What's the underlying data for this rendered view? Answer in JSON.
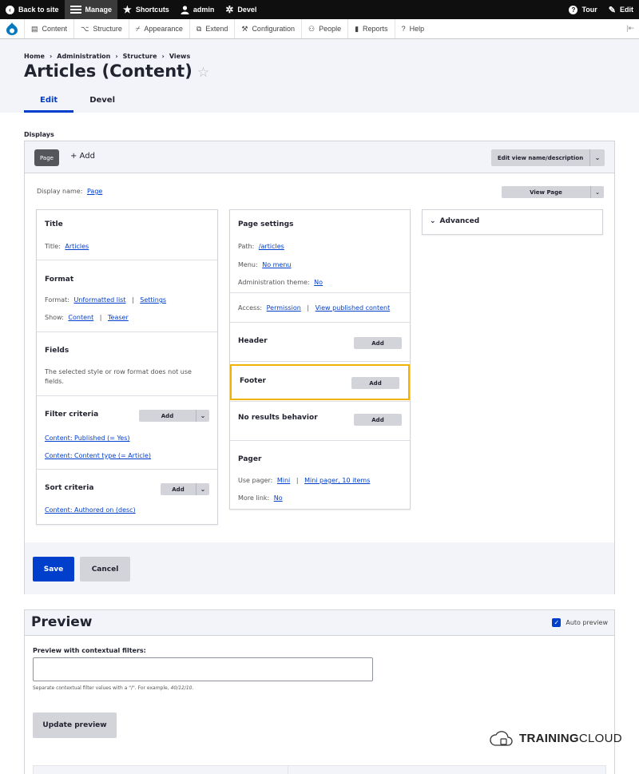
{
  "toolbar": {
    "back_to_site": "Back to site",
    "manage": "Manage",
    "shortcuts": "Shortcuts",
    "user": "admin",
    "devel": "Devel",
    "tour": "Tour",
    "edit": "Edit"
  },
  "tray": {
    "items": [
      {
        "label": "Content",
        "icon": "document-icon"
      },
      {
        "label": "Structure",
        "icon": "structure-icon"
      },
      {
        "label": "Appearance",
        "icon": "brush-icon"
      },
      {
        "label": "Extend",
        "icon": "puzzle-icon"
      },
      {
        "label": "Configuration",
        "icon": "wrench-icon"
      },
      {
        "label": "People",
        "icon": "people-icon"
      },
      {
        "label": "Reports",
        "icon": "bar-chart-icon"
      },
      {
        "label": "Help",
        "icon": "help-icon"
      }
    ]
  },
  "breadcrumb": [
    "Home",
    "Administration",
    "Structure",
    "Views"
  ],
  "page": {
    "title": "Articles (Content)",
    "star": "☆",
    "tabs": [
      "Edit",
      "Devel"
    ]
  },
  "displays": {
    "label": "Displays",
    "page_tab": "Page",
    "add": "+ Add",
    "edit_name": "Edit view name/description",
    "display_name_label": "Display name:",
    "display_name_value": "Page",
    "view_page": "View Page"
  },
  "col1": {
    "title": {
      "heading": "Title",
      "label": "Title:",
      "value": "Articles"
    },
    "format": {
      "heading": "Format",
      "format_label": "Format:",
      "format_value": "Unformatted list",
      "settings": "Settings",
      "show_label": "Show:",
      "show_value": "Content",
      "show_mode": "Teaser"
    },
    "fields": {
      "heading": "Fields",
      "note": "The selected style or row format does not use fields."
    },
    "filter": {
      "heading": "Filter criteria",
      "add": "Add",
      "items": [
        "Content: Published (= Yes)",
        "Content: Content type (= Article)"
      ]
    },
    "sort": {
      "heading": "Sort criteria",
      "add": "Add",
      "items": [
        "Content: Authored on (desc)"
      ]
    }
  },
  "col2": {
    "page_settings": {
      "heading": "Page settings",
      "path_label": "Path:",
      "path_value": "/articles",
      "menu_label": "Menu:",
      "menu_value": "No menu",
      "theme_label": "Administration theme:",
      "theme_value": "No",
      "access_label": "Access:",
      "access_value": "Permission",
      "access_perm": "View published content"
    },
    "header": {
      "heading": "Header",
      "add": "Add"
    },
    "footer": {
      "heading": "Footer",
      "add": "Add"
    },
    "no_results": {
      "heading": "No results behavior",
      "add": "Add"
    },
    "pager": {
      "heading": "Pager",
      "use_label": "Use pager:",
      "use_value": "Mini",
      "use_detail": "Mini pager, 10 items",
      "more_label": "More link:",
      "more_value": "No"
    }
  },
  "col3": {
    "advanced": "Advanced"
  },
  "actions": {
    "save": "Save",
    "cancel": "Cancel"
  },
  "preview": {
    "title": "Preview",
    "auto_preview": "Auto preview",
    "auto_checked": true,
    "contextual_label": "Preview with contextual filters:",
    "contextual_value": "",
    "help_prefix": "Separate contextual filter values with a \"/\". For example,",
    "help_example": "40/12/10",
    "help_suffix": ".",
    "update": "Update preview"
  },
  "watermark": {
    "bold": "TRAINING",
    "regular": "CLOUD"
  },
  "colors": {
    "accent": "#003ecc",
    "highlight": "#f0b400",
    "toolbar": "#0f0f0f"
  }
}
